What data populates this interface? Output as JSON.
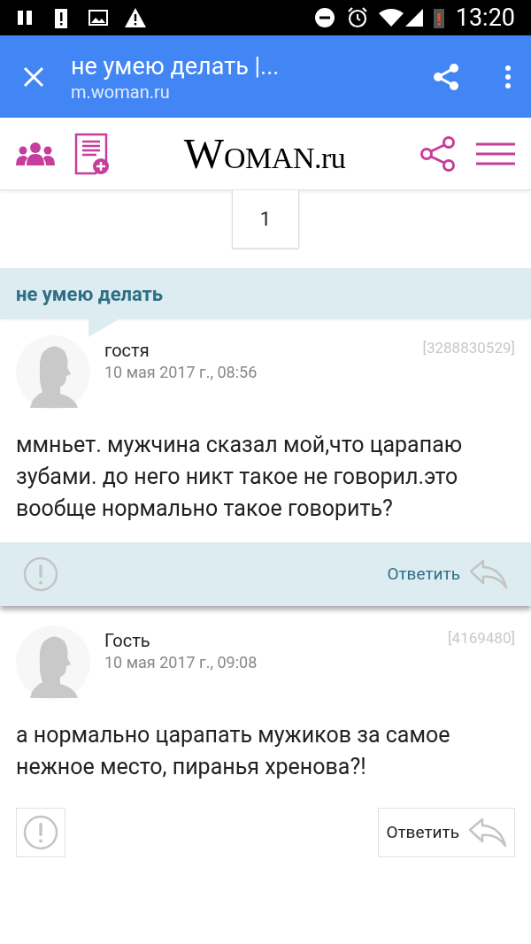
{
  "status_bar": {
    "time": "13:20"
  },
  "browser_bar": {
    "title": "не умею делать |...",
    "url": "m.woman.ru"
  },
  "site_header": {
    "logo": "WOMAN.ru"
  },
  "pagination": {
    "pages": [
      {
        "label": "1",
        "selected": true
      }
    ]
  },
  "topic": {
    "title": "не умею делать"
  },
  "comments": [
    {
      "author": "гостя",
      "date": "10 мая 2017 г., 08:56",
      "id": "[3288830529]",
      "text": "ммньет. мужчина сказал мой,что царапаю зубами. до него никт такое не говорил.это вообще нормально такое говорить?",
      "reply": "Ответить",
      "highlighted": true
    },
    {
      "author": "Гость",
      "date": "10 мая 2017 г., 09:08",
      "id": "[4169480]",
      "text": "а нормально царапать мужиков за самое нежное место, пиранья хренова?!",
      "reply": "Ответить",
      "highlighted": false
    }
  ]
}
